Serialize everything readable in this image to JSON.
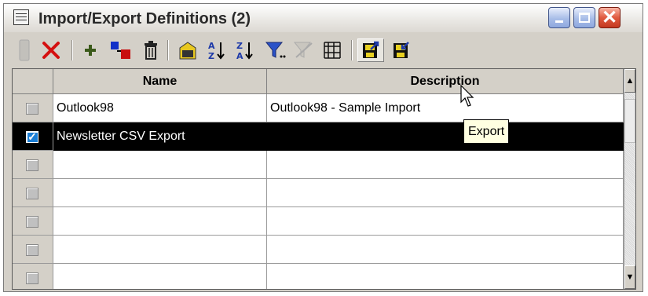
{
  "window": {
    "title": "Import/Export Definitions (2)"
  },
  "titlebar_buttons": {
    "minimize_icon": "minimize-icon",
    "maximize_icon": "maximize-icon",
    "close_glyph": "✕"
  },
  "toolbar": {
    "icons": [
      "blank-button",
      "delete-x-icon",
      "add-icon",
      "move-icon",
      "trash-icon",
      "tag-all-icon",
      "sort-ascending-icon",
      "sort-descending-icon",
      "filter-icon",
      "clear-filter-icon",
      "columns-grid-icon",
      "export-icon",
      "import-icon"
    ]
  },
  "table": {
    "columns": [
      "Name",
      "Description"
    ],
    "rows": [
      {
        "name": "Outlook98",
        "description": "Outlook98 - Sample Import",
        "checked": false,
        "selected": false
      },
      {
        "name": "Newsletter CSV Export",
        "description": "",
        "checked": true,
        "selected": true
      },
      {
        "name": "",
        "description": "",
        "checked": false,
        "selected": false
      },
      {
        "name": "",
        "description": "",
        "checked": false,
        "selected": false
      },
      {
        "name": "",
        "description": "",
        "checked": false,
        "selected": false
      },
      {
        "name": "",
        "description": "",
        "checked": false,
        "selected": false
      }
    ]
  },
  "scrollbar": {
    "up_glyph": "▲",
    "down_glyph": "▼"
  },
  "tooltip": {
    "text": "Export"
  },
  "colors": {
    "selected_row_bg": "#000000",
    "window_face": "#d4d0c8",
    "tooltip_bg": "#ffffe1"
  }
}
